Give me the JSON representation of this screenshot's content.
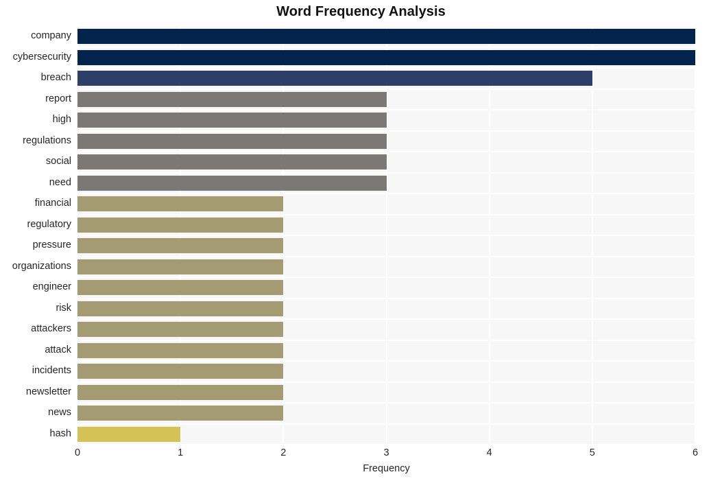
{
  "chart_data": {
    "type": "bar",
    "orientation": "horizontal",
    "title": "Word Frequency Analysis",
    "xlabel": "Frequency",
    "ylabel": "",
    "xlim": [
      0,
      6
    ],
    "xticks": [
      "0",
      "1",
      "2",
      "3",
      "4",
      "5",
      "6"
    ],
    "grid": true,
    "legend": "none",
    "categories": [
      "company",
      "cybersecurity",
      "breach",
      "report",
      "high",
      "regulations",
      "social",
      "need",
      "financial",
      "regulatory",
      "pressure",
      "organizations",
      "engineer",
      "risk",
      "attackers",
      "attack",
      "incidents",
      "newsletter",
      "news",
      "hash"
    ],
    "values": [
      6,
      6,
      5,
      3,
      3,
      3,
      3,
      3,
      2,
      2,
      2,
      2,
      2,
      2,
      2,
      2,
      2,
      2,
      2,
      1
    ],
    "bar_colors": [
      "#02234c",
      "#02234c",
      "#2d3e68",
      "#7a7976",
      "#7a7976",
      "#7a7976",
      "#7a7976",
      "#7a7976",
      "#a49b72",
      "#a49b72",
      "#a49b72",
      "#a49b72",
      "#a49b72",
      "#a49b72",
      "#a49b72",
      "#a49b72",
      "#a49b72",
      "#a49b72",
      "#a49b72",
      "#d4c257"
    ]
  },
  "style": {
    "plot_background": "#f7f7f7",
    "gridline_color": "#ffffff",
    "page_background": "#ffffff",
    "text_color": "#262626",
    "title_color": "#111111"
  }
}
